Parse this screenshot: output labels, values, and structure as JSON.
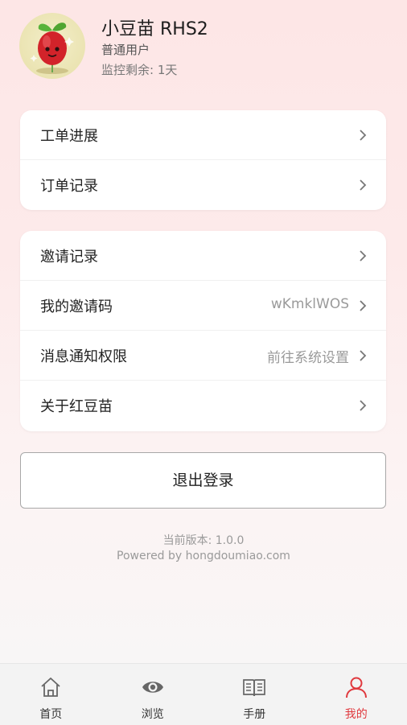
{
  "profile": {
    "name": "小豆苗 RHS2",
    "role": "普通用户",
    "remaining": "监控剩余: 1天"
  },
  "menu_group_1": [
    {
      "label": "工单进展",
      "value": ""
    },
    {
      "label": "订单记录",
      "value": ""
    }
  ],
  "menu_group_2": [
    {
      "label": "邀请记录",
      "value": ""
    },
    {
      "label": "我的邀请码",
      "value": "wKmklWOS"
    },
    {
      "label": "消息通知权限",
      "value": "前往系统设置"
    },
    {
      "label": "关于红豆苗",
      "value": ""
    }
  ],
  "logout_label": "退出登录",
  "footer": {
    "version": "当前版本: 1.0.0",
    "powered": "Powered by hongdoumiao.com"
  },
  "tabs": [
    {
      "label": "首页",
      "icon": "home-icon",
      "active": false
    },
    {
      "label": "浏览",
      "icon": "eye-icon",
      "active": false
    },
    {
      "label": "手册",
      "icon": "book-icon",
      "active": false
    },
    {
      "label": "我的",
      "icon": "user-icon",
      "active": true
    }
  ],
  "colors": {
    "accent": "#e0393e",
    "background_top": "#fde6e6",
    "text_secondary": "#9a9a9a"
  }
}
